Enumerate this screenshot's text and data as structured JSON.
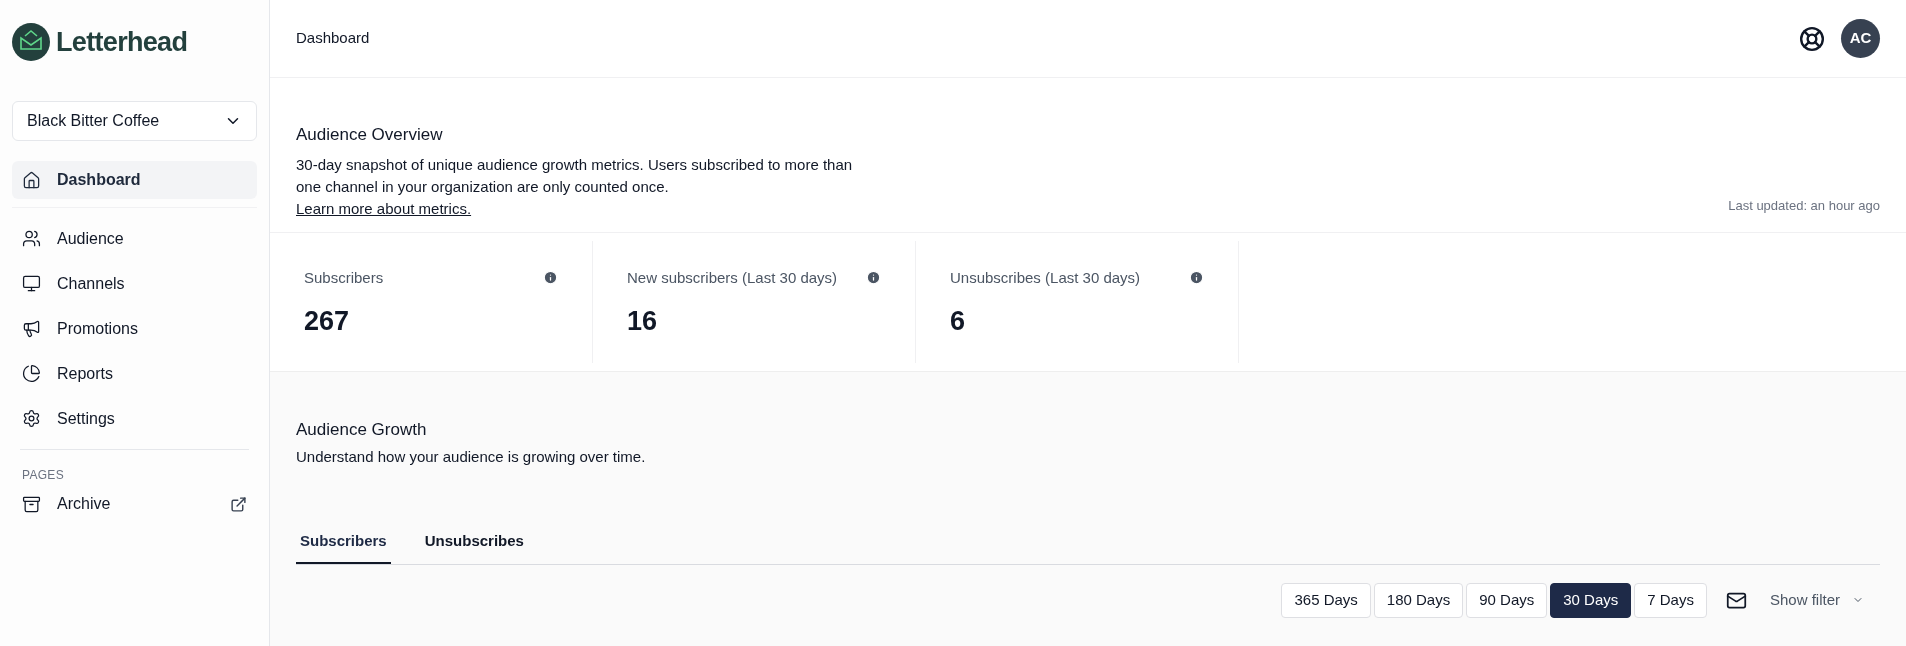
{
  "sidebar": {
    "logo": "Letterhead",
    "organization": "Black Bitter Coffee",
    "items": [
      {
        "label": "Dashboard",
        "kind": "home",
        "selected": true
      },
      {
        "label": "Audience",
        "kind": "users",
        "selected": false
      },
      {
        "label": "Channels",
        "kind": "monitor",
        "selected": false
      },
      {
        "label": "Promotions",
        "kind": "megaphone",
        "selected": false
      },
      {
        "label": "Reports",
        "kind": "chart",
        "selected": false
      },
      {
        "label": "Settings",
        "kind": "settings",
        "selected": false
      }
    ],
    "section_label": "PAGES",
    "pages": [
      {
        "label": "Archive",
        "kind": "archive",
        "external": true
      }
    ]
  },
  "header": {
    "title": "Dashboard",
    "avatar": "AC"
  },
  "overview": {
    "title": "Audience Overview",
    "description": "30-day snapshot of unique audience growth metrics. Users subscribed to more than one channel in your organization are only counted once.",
    "link": "Learn more about metrics.",
    "last_updated": "Last updated: an hour ago",
    "metrics": [
      {
        "label": "Subscribers",
        "value": "267"
      },
      {
        "label": "New subscribers (Last 30 days)",
        "value": "16"
      },
      {
        "label": "Unsubscribes (Last 30 days)",
        "value": "6"
      }
    ]
  },
  "growth": {
    "title": "Audience Growth",
    "description": "Understand how your audience is growing over time.",
    "tabs": [
      {
        "label": "Subscribers",
        "selected": true
      },
      {
        "label": "Unsubscribes",
        "selected": false
      }
    ],
    "ranges": [
      {
        "label": "365 Days",
        "selected": false
      },
      {
        "label": "180 Days",
        "selected": false
      },
      {
        "label": "90 Days",
        "selected": false
      },
      {
        "label": "30 Days",
        "selected": true
      },
      {
        "label": "7 Days",
        "selected": false
      }
    ],
    "filter": "Show filter"
  }
}
